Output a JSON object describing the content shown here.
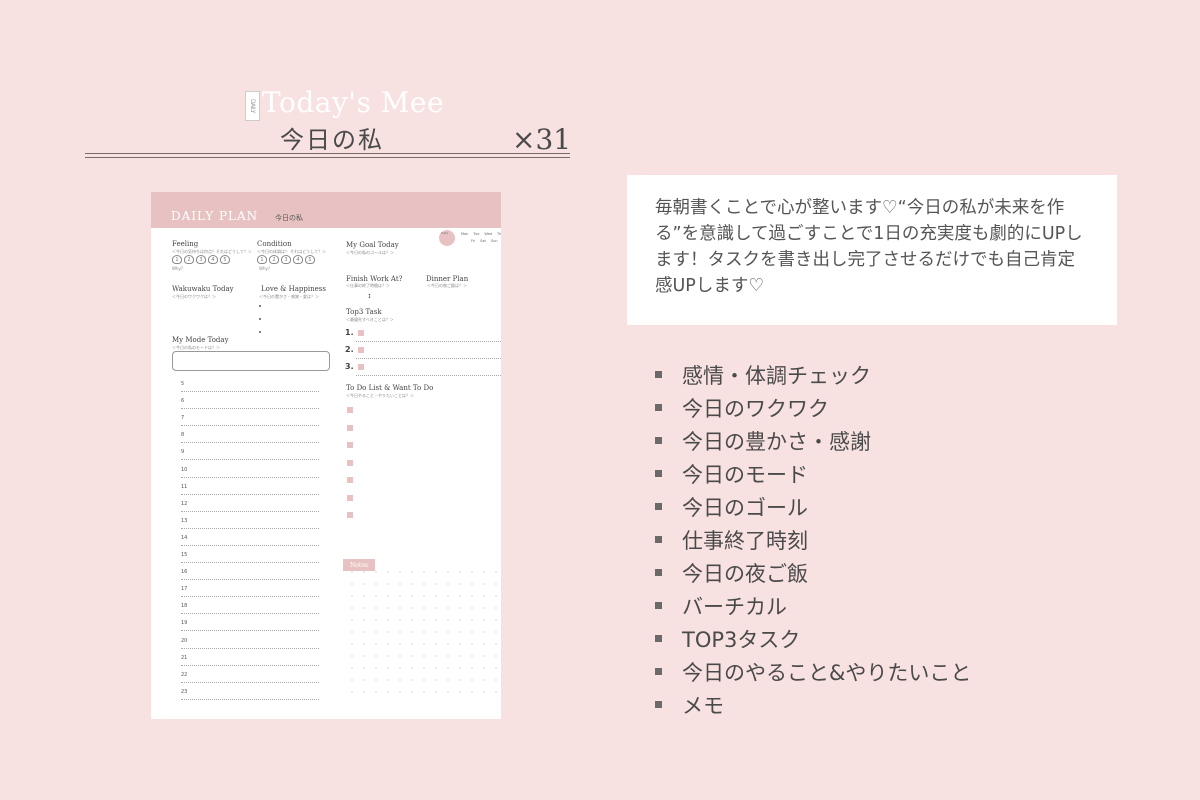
{
  "header": {
    "badge": "DAILY",
    "title_en": "Today's Mee",
    "title_jp": "今日の私",
    "count": "×31"
  },
  "planner": {
    "band_title": "DAILY PLAN",
    "band_sub": "今日の私",
    "feeling": {
      "label": "Feeling",
      "sub": "＜今日の気持ちは何点？それはどうして？＞",
      "why": "Why?",
      "hearts": [
        "1",
        "2",
        "3",
        "4",
        "5"
      ]
    },
    "condition": {
      "label": "Condition",
      "sub": "＜今日の体調は？ それはどうして？＞",
      "why": "Why?",
      "hearts": [
        "1",
        "2",
        "3",
        "4",
        "5"
      ]
    },
    "wakuwaku": {
      "label": "Wakuwaku Today",
      "sub": "＜今日のワクワクは？＞"
    },
    "love": {
      "label": "Love & Happiness",
      "sub": "＜今日の豊かさ・感謝・愛は？＞"
    },
    "mode": {
      "label": "My Mode Today",
      "sub": "＜今日の私のモードは？＞"
    },
    "hours": [
      "5",
      "6",
      "7",
      "8",
      "9",
      "10",
      "11",
      "12",
      "13",
      "14",
      "15",
      "16",
      "17",
      "18",
      "19",
      "20",
      "21",
      "22",
      "23"
    ],
    "date": {
      "label": "Date",
      "week1": [
        "Mon",
        "Tue",
        "Wed",
        "Thu"
      ],
      "week2": [
        "Fri",
        "Sat",
        "Sun"
      ]
    },
    "goal": {
      "label": "My Goal Today",
      "sub": "＜今日の私のゴールは？＞"
    },
    "finish": {
      "label": "Finish Work At?",
      "sub": "＜仕事の終了時間は？＞",
      "colon": ":"
    },
    "dinner": {
      "label": "Dinner Plan",
      "sub": "＜今日の夜ご飯は？＞"
    },
    "top3": {
      "label": "Top3 Task",
      "sub": "＜最優先すべきことは？＞",
      "nums": [
        "1.",
        "2.",
        "3."
      ]
    },
    "todo": {
      "label": "To Do List & Want To Do",
      "sub": "＜今日やること・やりたいことは？＞"
    },
    "notes": "Notes"
  },
  "description": "毎朝書くことで心が整います♡“今日の私が未来を作る”を意識して過ごすことで1日の充実度も劇的にUPします！タスクを書き出し完了させるだけでも自己肯定感UPします♡",
  "features": [
    "感情・体調チェック",
    "今日のワクワク",
    "今日の豊かさ・感謝",
    "今日のモード",
    "今日のゴール",
    "仕事終了時刻",
    "今日の夜ご飯",
    "バーチカル",
    "TOP3タスク",
    "今日のやること&やりたいこと",
    "メモ"
  ]
}
